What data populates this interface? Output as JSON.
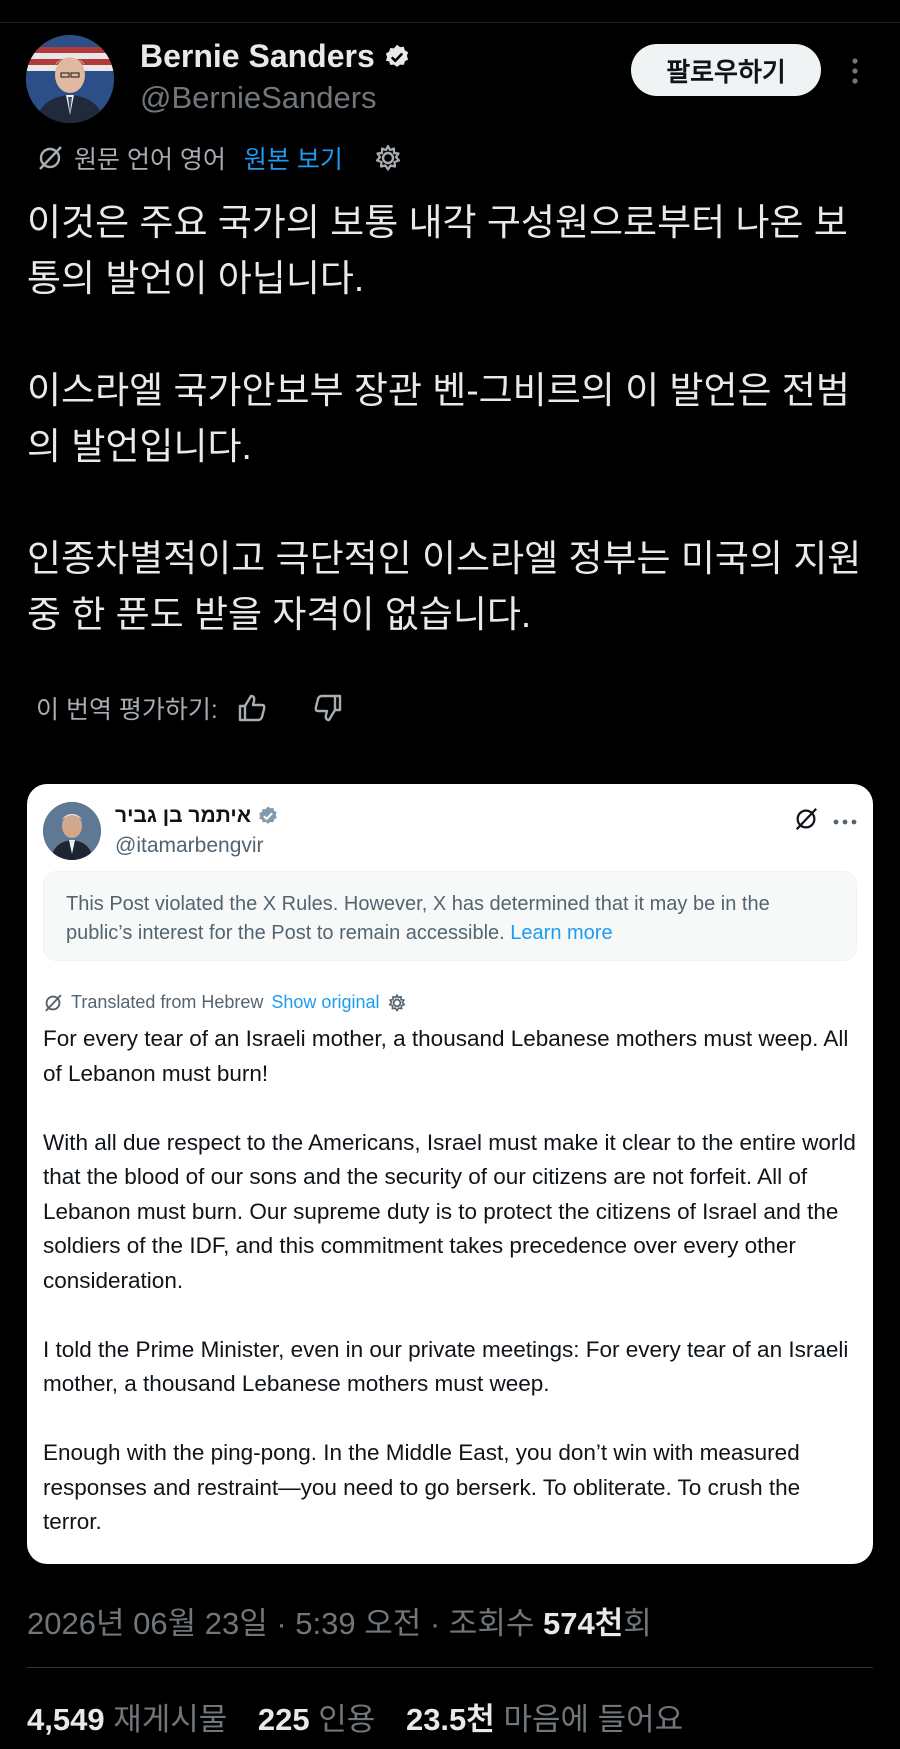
{
  "author": {
    "name": "Bernie Sanders",
    "handle": "@BernieSanders",
    "follow_label": "팔로우하기"
  },
  "translation": {
    "source_label": "원문 언어 영어",
    "show_original": "원본 보기"
  },
  "post": {
    "paragraphs": [
      "이것은 주요 국가의 보통 내각 구성원으로부터 나온 보통의 발언이 아닙니다.",
      "이스라엘 국가안보부 장관 벤-그비르의 이 발언은 전범의 발언입니다.",
      "인종차별적이고 극단적인 이스라엘 정부는 미국의 지원 중 한 푼도 받을 자격이 없습니다."
    ],
    "rate_label": "이 번역 평가하기:"
  },
  "quote": {
    "name": "איתמר בן גביר",
    "handle": "@itamarbengvir",
    "notice_text": "This Post violated the X Rules. However, X has determined that it may be in the public’s interest for the Post to remain accessible.",
    "notice_link": "Learn more",
    "translated_label": "Translated from Hebrew",
    "show_original": "Show original",
    "paragraphs": [
      "For every tear of an Israeli mother, a thousand Lebanese mothers must weep. All of Lebanon must burn!",
      "With all due respect to the Americans, Israel must make it clear to the entire world that the blood of our sons and the security of our citizens are not forfeit. All of Lebanon must burn. Our supreme duty is to protect the citizens of Israel and the soldiers of the IDF, and this commitment takes precedence over every other consideration.",
      "I told the Prime Minister, even in our private meetings: For every tear of an Israeli mother, a thousand Lebanese mothers must weep.",
      "Enough with the ping-pong. In the Middle East, you don’t win with measured responses and restraint—you need to go berserk. To obliterate. To crush the terror."
    ]
  },
  "meta": {
    "datetime": "2026년 06월 23일 · 5:39 오전 · 조회수 ",
    "views": "574천",
    "views_suffix": "회"
  },
  "stats": {
    "reposts_count": "4,549",
    "reposts_label": "재게시물",
    "quotes_count": "225",
    "quotes_label": "인용",
    "likes_count": "23.5천",
    "likes_label": "마음에 들어요"
  },
  "colors": {
    "accent": "#1d9bf0",
    "background": "#000000",
    "text": "#e7e9ea",
    "muted": "#71767b"
  }
}
